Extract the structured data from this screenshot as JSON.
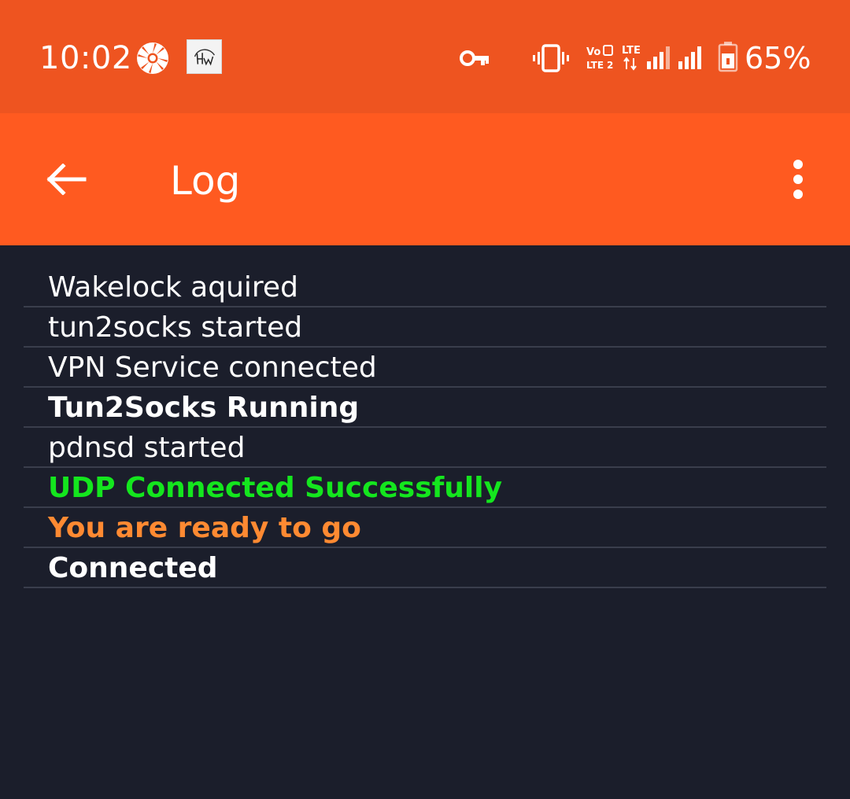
{
  "status_bar": {
    "time": "10:02",
    "battery_percent": "65%",
    "network": "LTE",
    "icons": [
      "aperture-icon",
      "hw-app-icon",
      "vpn-key-icon",
      "vibrate-icon",
      "volte-icon",
      "lte-signal-icon",
      "battery-icon"
    ]
  },
  "app_bar": {
    "title": "Log",
    "back_icon": "arrow-back-icon",
    "menu_icon": "more-vert-icon"
  },
  "log": {
    "entries": [
      {
        "text": "Wakelock aquired",
        "style": "normal"
      },
      {
        "text": "tun2socks started",
        "style": "normal"
      },
      {
        "text": "VPN Service connected",
        "style": "normal"
      },
      {
        "text": "Tun2Socks Running",
        "style": "bold"
      },
      {
        "text": "pdnsd started",
        "style": "normal"
      },
      {
        "text": "UDP Connected Successfully",
        "style": "success"
      },
      {
        "text": "You are ready to go",
        "style": "ready"
      },
      {
        "text": "Connected",
        "style": "bold"
      }
    ]
  },
  "colors": {
    "status_bar": "#ee5420",
    "app_bar": "#ff5a20",
    "background": "#1b1e2b",
    "divider": "#3a3e4c",
    "success": "#14e61e",
    "ready": "#ff8a32",
    "text": "#ffffff"
  }
}
